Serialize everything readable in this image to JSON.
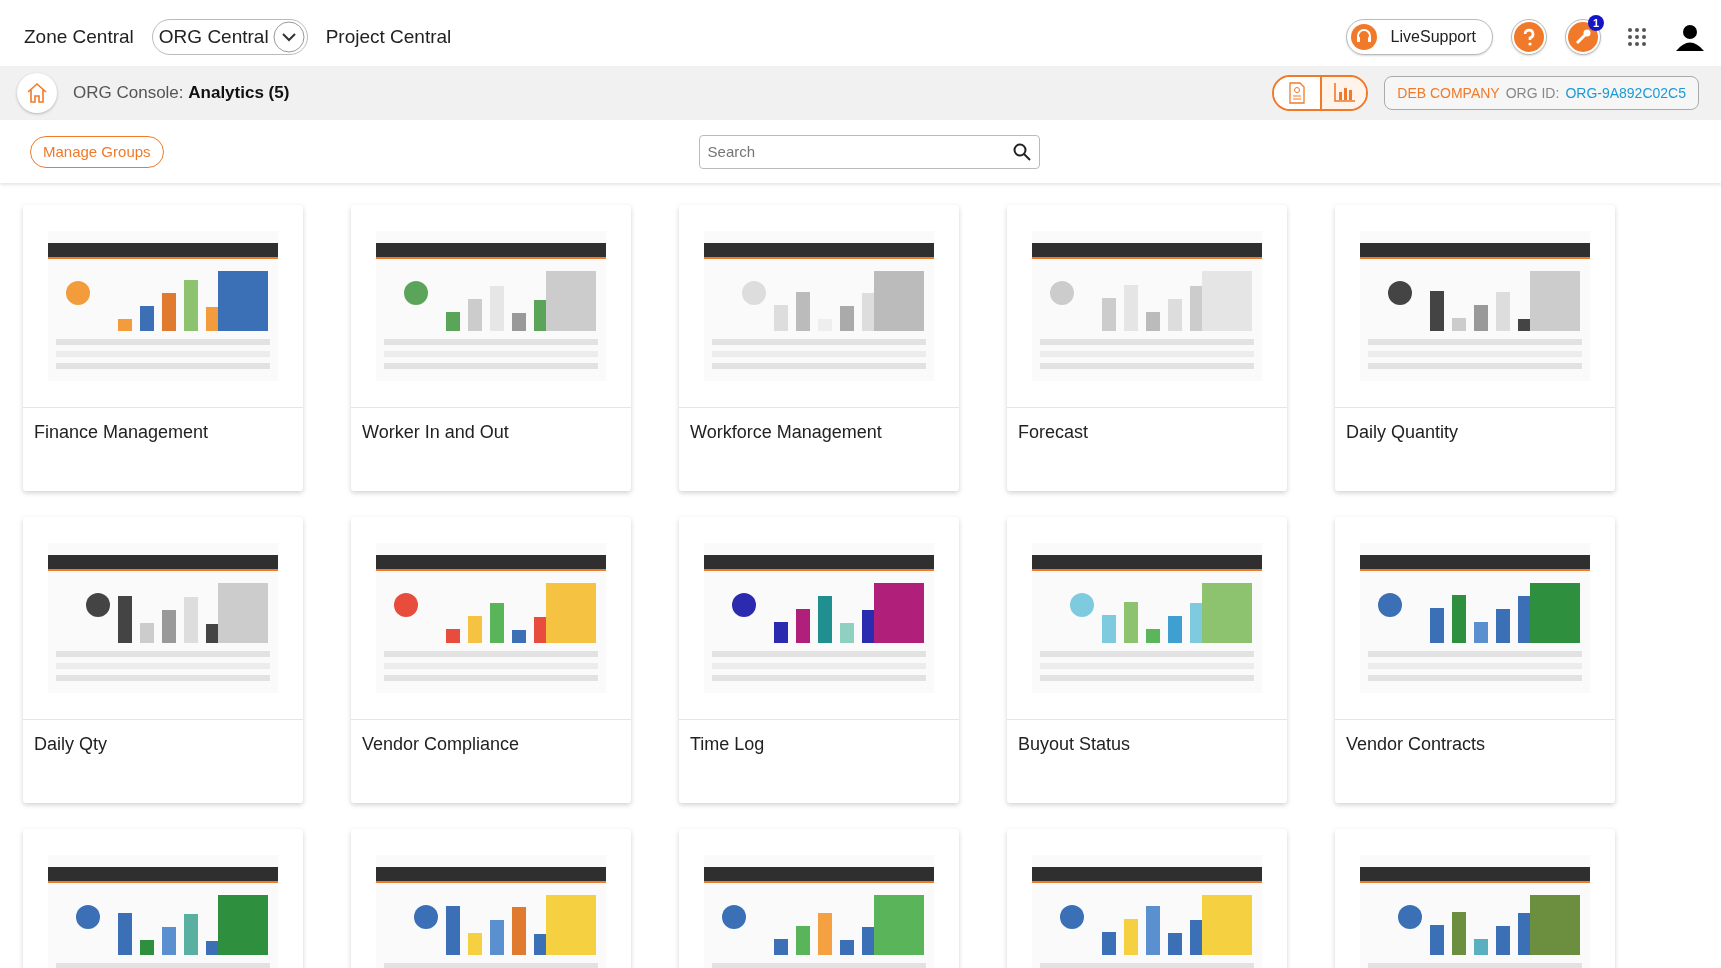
{
  "top_nav": {
    "links": [
      {
        "label": "Zone Central",
        "kind": "link"
      },
      {
        "label": "ORG Central",
        "kind": "dropdown"
      },
      {
        "label": "Project Central",
        "kind": "link"
      }
    ],
    "live_support": "LiveSupport",
    "notification_badge": "1"
  },
  "console_bar": {
    "prefix": "ORG Console:",
    "title": "Analytics (5)",
    "view_toggle": [
      {
        "selected": false
      },
      {
        "selected": true
      }
    ],
    "company": "DEB COMPANY",
    "org_id_label": "ORG ID:",
    "org_id": "ORG-9A892C02C5"
  },
  "toolbar": {
    "manage_groups": "Manage Groups",
    "search": {
      "placeholder": "Search"
    }
  },
  "cards": [
    {
      "title": "Finance Management",
      "kind": "picture"
    },
    {
      "title": "Worker In and Out",
      "kind": "picture"
    },
    {
      "title": "Workforce Management",
      "kind": "picture"
    },
    {
      "title": "Forecast",
      "kind": "picture"
    },
    {
      "title": "Daily Quantity",
      "kind": "picture"
    },
    {
      "title": "Daily Qty",
      "kind": "picture"
    },
    {
      "title": "Vendor Compliance",
      "kind": "picture"
    },
    {
      "title": "Time Log",
      "kind": "picture"
    },
    {
      "title": "Buyout Status",
      "kind": "picture"
    },
    {
      "title": "Vendor Contracts",
      "kind": "picture"
    },
    {
      "kind": "picture"
    },
    {
      "kind": "picture"
    },
    {
      "kind": "picture"
    },
    {
      "kind": "picture"
    },
    {
      "kind": "picture"
    }
  ]
}
